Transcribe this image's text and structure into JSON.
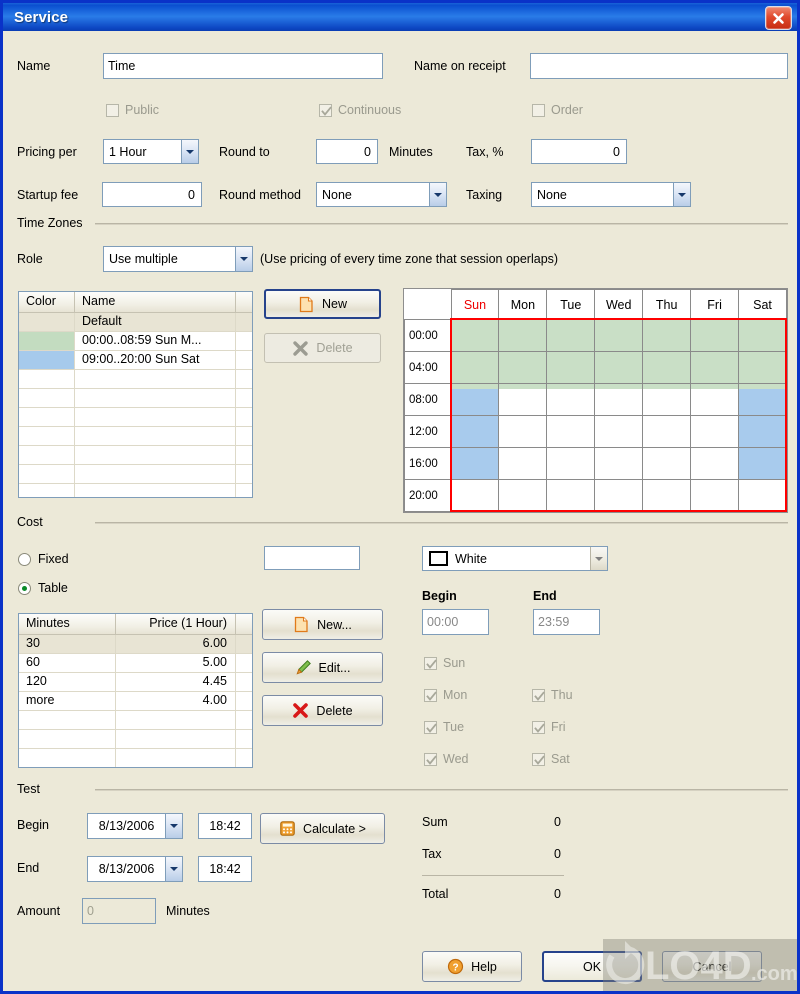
{
  "window": {
    "title": "Service",
    "close_label": "Close",
    "close_icon": "close-icon"
  },
  "top": {
    "name_label": "Name",
    "name_value": "Time",
    "name_receipt_label": "Name on receipt",
    "name_receipt_value": "",
    "public_label": "Public",
    "public_checked": false,
    "continuous_label": "Continuous",
    "continuous_checked": true,
    "order_label": "Order",
    "order_checked": false
  },
  "pricing": {
    "pricing_per_label": "Pricing per",
    "pricing_per_value": "1 Hour",
    "round_to_label": "Round to",
    "round_to_value": "0",
    "minutes_label": "Minutes",
    "tax_label": "Tax, %",
    "tax_value": "0",
    "startup_fee_label": "Startup fee",
    "startup_fee_value": "0",
    "round_method_label": "Round method",
    "round_method_value": "None",
    "taxing_label": "Taxing",
    "taxing_value": "None"
  },
  "timezones": {
    "group_label": "Time Zones",
    "role_label": "Role",
    "role_value": "Use multiple",
    "role_hint": "(Use pricing of every time zone that session operlaps)",
    "columns": [
      "Color",
      "Name"
    ],
    "rows": [
      {
        "color": "",
        "name": "Default",
        "selected": true
      },
      {
        "color": "#c3dcc0",
        "name": "00:00..08:59 Sun M...",
        "selected": false
      },
      {
        "color": "#a6caec",
        "name": "09:00..20:00 Sun Sat",
        "selected": false
      }
    ],
    "new_label": "New",
    "new_icon": "new-document-icon",
    "delete_label": "Delete",
    "delete_icon": "delete-x-icon",
    "delete_enabled": false
  },
  "calendar": {
    "days": [
      "Sun",
      "Mon",
      "Tue",
      "Wed",
      "Thu",
      "Fri",
      "Sat"
    ],
    "hours": [
      "00:00",
      "04:00",
      "08:00",
      "12:00",
      "16:00",
      "20:00"
    ],
    "green_color": "#c9dfc6",
    "blue_color": "#a8cbed",
    "selection_border_color": "#ff0000",
    "green_zone": "00:00..08:59 all days",
    "blue_zone": "09:00..20:00 Sun Sat"
  },
  "cost": {
    "group_label": "Cost",
    "fixed_label": "Fixed",
    "table_label": "Table",
    "mode": "Table",
    "fixed_value": "",
    "columns": [
      "Minutes",
      "Price (1 Hour)"
    ],
    "rows": [
      {
        "minutes": "30",
        "price": "6.00",
        "selected": true
      },
      {
        "minutes": "60",
        "price": "5.00",
        "selected": false
      },
      {
        "minutes": "120",
        "price": "4.45",
        "selected": false
      },
      {
        "minutes": "more",
        "price": "4.00",
        "selected": false
      }
    ],
    "new_label": "New...",
    "new_icon": "new-document-icon",
    "edit_label": "Edit...",
    "edit_icon": "pencil-icon",
    "delete_label": "Delete",
    "delete_icon": "delete-x-icon"
  },
  "zone_editor": {
    "color_label": "White",
    "color_swatch": "#ffffff",
    "begin_label": "Begin",
    "begin_value": "00:00",
    "end_label": "End",
    "end_value": "23:59",
    "days": [
      {
        "label": "Sun",
        "checked": true
      },
      {
        "label": "Mon",
        "checked": true
      },
      {
        "label": "Tue",
        "checked": true
      },
      {
        "label": "Wed",
        "checked": true
      },
      {
        "label": "Thu",
        "checked": true
      },
      {
        "label": "Fri",
        "checked": true
      },
      {
        "label": "Sat",
        "checked": true
      }
    ]
  },
  "test": {
    "group_label": "Test",
    "begin_label": "Begin",
    "begin_date": "8/13/2006",
    "begin_time": "18:42",
    "end_label": "End",
    "end_date": "8/13/2006",
    "end_time": "18:42",
    "amount_label": "Amount",
    "amount_value": "0",
    "minutes_label": "Minutes",
    "calculate_label": "Calculate >",
    "calculate_icon": "calculator-icon",
    "sum_label": "Sum",
    "sum_value": "0",
    "tax_label": "Tax",
    "tax_value": "0",
    "total_label": "Total",
    "total_value": "0"
  },
  "footer": {
    "help_label": "Help",
    "help_icon": "question-mark-icon",
    "ok_label": "OK",
    "cancel_label": "Cancel"
  },
  "watermark": {
    "text": "LO4D",
    "suffix": ".com"
  }
}
